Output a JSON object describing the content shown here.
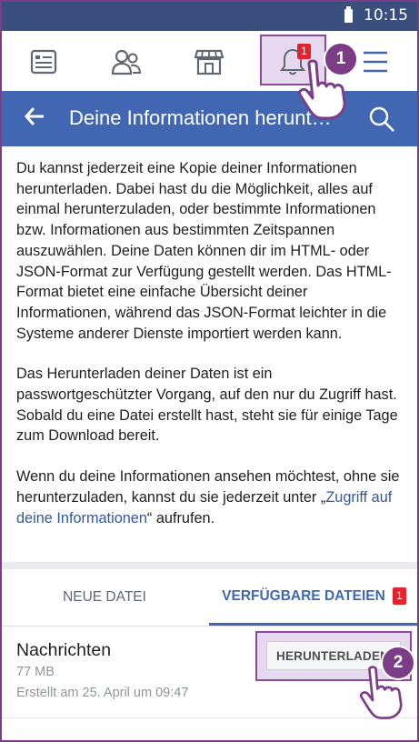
{
  "status_bar": {
    "time": "10:15"
  },
  "nav": {
    "items": [
      {
        "icon": "news-feed-icon"
      },
      {
        "icon": "friends-icon"
      },
      {
        "icon": "marketplace-icon"
      },
      {
        "icon": "notifications-bell-icon",
        "badge": "1"
      },
      {
        "icon": "menu-icon"
      }
    ]
  },
  "header": {
    "title": "Deine Informationen herunt…"
  },
  "content": {
    "paragraph1": "Du kannst jederzeit eine Kopie deiner Informationen herunterladen. Dabei hast du die Möglichkeit, alles auf einmal herunterzuladen, oder bestimmte Informationen bzw. Informationen aus bestimmten Zeitspannen auszuwählen. Deine Daten können dir im HTML- oder JSON-Format zur Verfügung gestellt werden. Das HTML-Format bietet eine einfache Übersicht deiner Informationen, während das JSON-Format leichter in die Systeme anderer Dienste importiert werden kann.",
    "paragraph2": "Das Herunterladen deiner Daten ist ein passwortgeschützter Vorgang, auf den nur du Zugriff hast. Sobald du eine Datei erstellt hast, steht sie für einige Tage zum Download bereit.",
    "paragraph3_before": "Wenn du deine Informationen ansehen möchtest, ohne sie herunterzuladen, kannst du sie jederzeit unter „",
    "paragraph3_link": "Zugriff auf deine Informationen",
    "paragraph3_after": "“ aufrufen."
  },
  "tabs": {
    "new_file": "NEUE DATEI",
    "available_files": "VERFÜGBARE DATEIEN",
    "available_badge": "1"
  },
  "file": {
    "name": "Nachrichten",
    "size": "77 MB",
    "created": "Erstellt am 25. April um 09:47",
    "download_label": "HERUNTERLADEN"
  },
  "steps": {
    "step1": "1",
    "step2": "2"
  },
  "colors": {
    "facebook_blue": "#4267b2",
    "accent_purple": "#7a3d86",
    "badge_red": "#e02531"
  }
}
